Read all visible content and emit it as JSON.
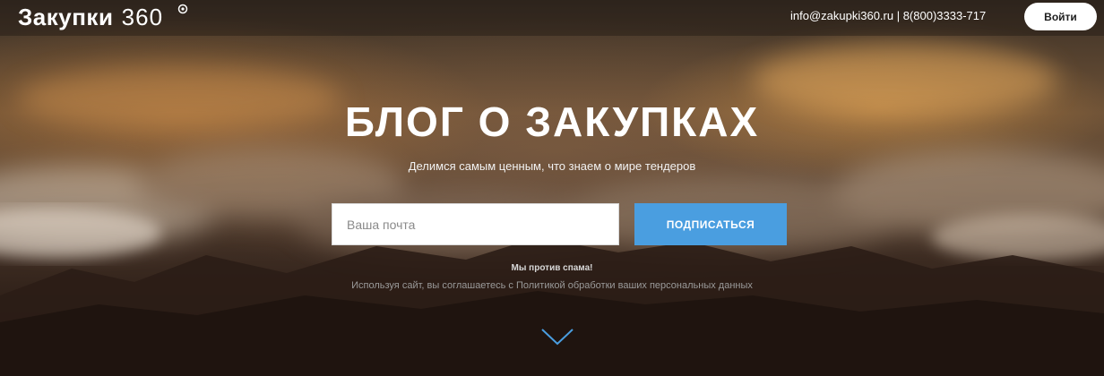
{
  "header": {
    "logo_word": "Закупки",
    "logo_number": "360",
    "contact": "info@zakupki360.ru | 8(800)3333-717",
    "login_label": "Войти"
  },
  "hero": {
    "title": "БЛОГ О ЗАКУПКАХ",
    "subtitle": "Делимся самым ценным, что знаем о мире тендеров",
    "email_placeholder": "Ваша почта",
    "subscribe_label": "ПОДПИСАТЬСЯ",
    "nospam": "Мы против спама!",
    "policy_text": "Используя сайт, вы соглашаетесь с Политикой обработки ваших персональных данных"
  },
  "icons": {
    "logo_mark": "eye-icon",
    "scroll": "chevron-down-icon"
  },
  "colors": {
    "accent": "#4a9ee0",
    "login_bg": "#ffffff"
  }
}
